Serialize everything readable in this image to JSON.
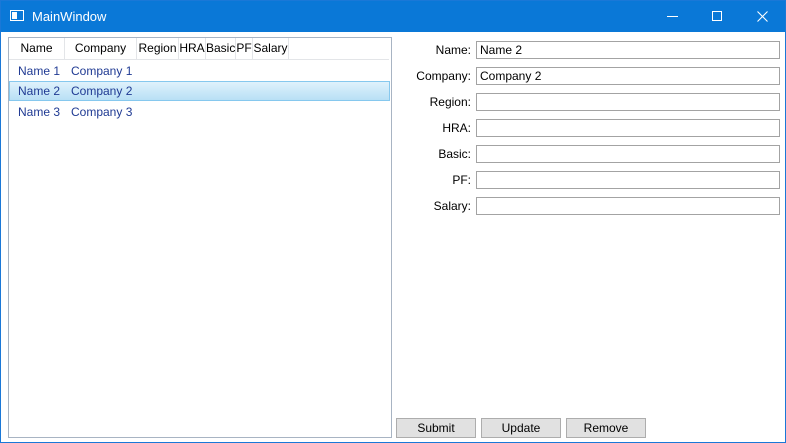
{
  "window": {
    "title": "MainWindow"
  },
  "list": {
    "columns": [
      "Name",
      "Company",
      "Region",
      "HRA",
      "Basic",
      "PF",
      "Salary"
    ],
    "rows": [
      {
        "name": "Name 1",
        "company": "Company 1"
      },
      {
        "name": "Name 2",
        "company": "Company 2"
      },
      {
        "name": "Name 3",
        "company": "Company 3"
      }
    ],
    "selected_index": 1
  },
  "form": {
    "name_label": "Name:",
    "name_value": "Name 2",
    "company_label": "Company:",
    "company_value": "Company 2",
    "region_label": "Region:",
    "region_value": "",
    "hra_label": "HRA:",
    "hra_value": "",
    "basic_label": "Basic:",
    "basic_value": "",
    "pf_label": "PF:",
    "pf_value": "",
    "salary_label": "Salary:",
    "salary_value": ""
  },
  "buttons": {
    "submit": "Submit",
    "update": "Update",
    "remove": "Remove"
  },
  "colors": {
    "titlebar": "#0a78d7",
    "selection": "#b8e0f5",
    "list_text": "#1f3a93"
  },
  "icons": {
    "app": "window-icon",
    "minimize": "minimize-icon",
    "maximize": "maximize-icon",
    "close": "close-icon"
  }
}
